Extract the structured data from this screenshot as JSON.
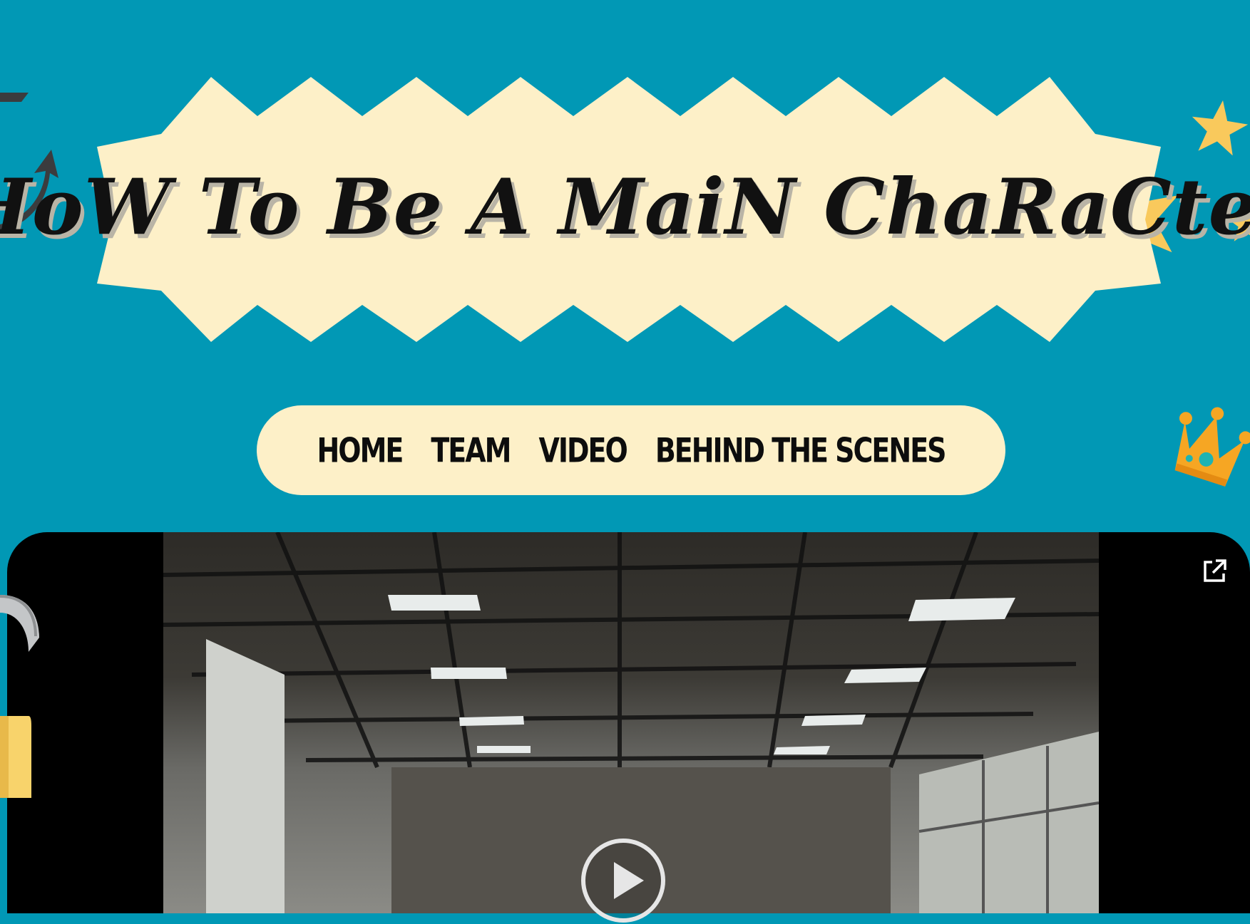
{
  "page": {
    "background_color": "#0198b5"
  },
  "header": {
    "title": "HoW To Be A MaiN ChaRaCter",
    "banner_color": "#fdf0c8"
  },
  "nav": {
    "items": [
      {
        "label": "HOME"
      },
      {
        "label": "TEAM"
      },
      {
        "label": "VIDEO"
      },
      {
        "label": "BEHIND THE SCENES"
      }
    ],
    "background_color": "#fdf0c8"
  },
  "video": {
    "frame_color": "#000000",
    "play_icon": "play-icon",
    "open_icon": "external-link-icon"
  },
  "decorations": {
    "arrow_icon": "curved-arrow-icon",
    "star_icon": "star-icon",
    "crown_icon": "crown-icon",
    "lock_icon": "lock-icon",
    "star_color": "#f9c95c",
    "crown_color": "#f6a623"
  }
}
